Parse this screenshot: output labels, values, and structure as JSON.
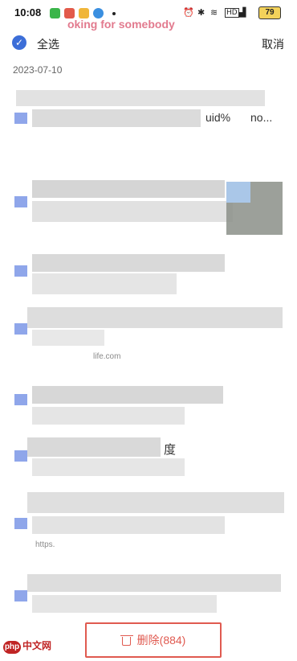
{
  "status_bar": {
    "time": "10:08",
    "hd": "HD",
    "battery": "79"
  },
  "overlay": {
    "text": "oking for somebody"
  },
  "header": {
    "select_all": "全选",
    "cancel": "取消"
  },
  "list": {
    "date": "2023-07-10",
    "items": [
      {
        "visible_text": "uid%",
        "extra": "no..."
      },
      {
        "visible_text": ""
      },
      {
        "visible_text": ""
      },
      {
        "visible_text": "",
        "url_fragment": "life.com"
      },
      {
        "visible_text": ""
      },
      {
        "visible_text": "度"
      },
      {
        "visible_text": "",
        "url_fragment": "https."
      },
      {
        "visible_text": ""
      }
    ]
  },
  "delete_button": {
    "label": "删除(884)"
  },
  "watermark": {
    "badge": "php",
    "text": "中文网"
  },
  "colors": {
    "accent_blue": "#3c6ed8",
    "danger_red": "#e05a50"
  }
}
